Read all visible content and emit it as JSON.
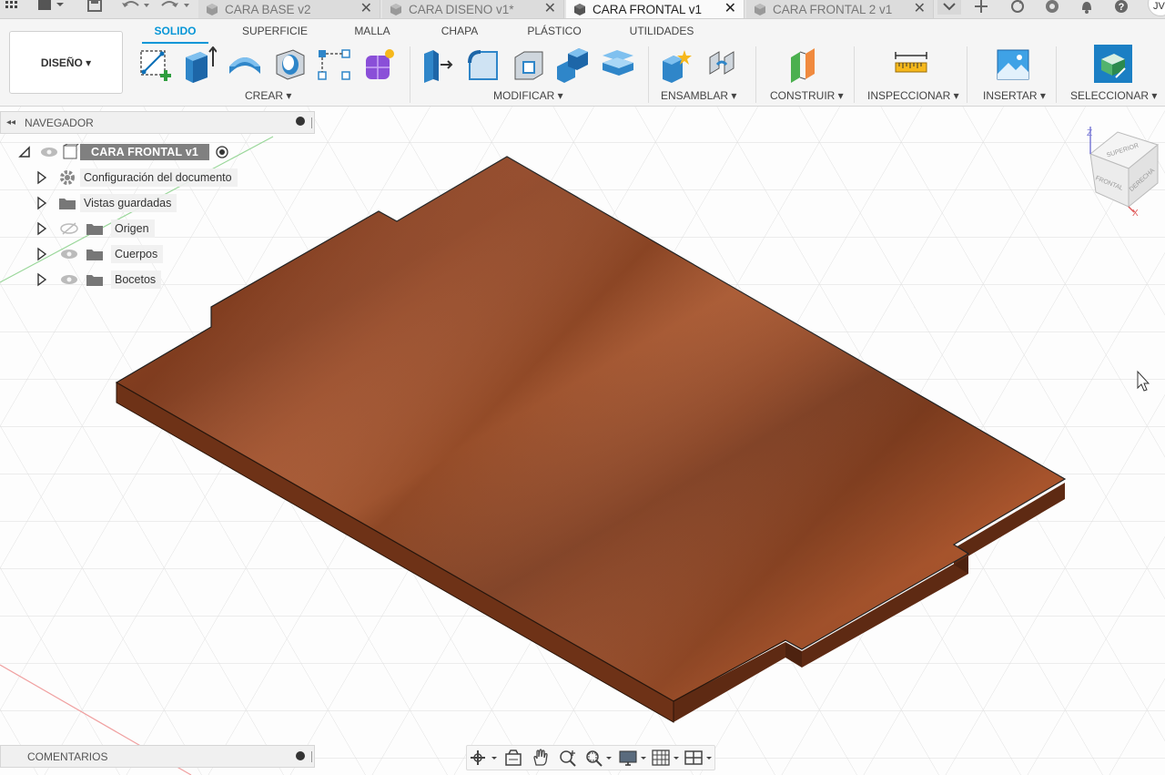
{
  "document_tabs": [
    {
      "name": "CARA BASE v2",
      "active": false
    },
    {
      "name": "CARA DISENO v1*",
      "active": false
    },
    {
      "name": "CARA FRONTAL v1",
      "active": true
    },
    {
      "name": "CARA FRONTAL 2 v1",
      "active": false
    }
  ],
  "tab_close_glyph": "✕",
  "user_initials": "JV",
  "workspace": {
    "label": "DISEÑO ▾"
  },
  "ribbon_tabs": [
    {
      "label": "SOLIDO",
      "active": true
    },
    {
      "label": "SUPERFICIE"
    },
    {
      "label": "MALLA"
    },
    {
      "label": "CHAPA"
    },
    {
      "label": "PLÁSTICO"
    },
    {
      "label": "UTILIDADES"
    }
  ],
  "tool_groups": [
    {
      "label": "CREAR ▾",
      "tools": [
        "create-sketch-icon",
        "extrude-icon",
        "revolve-icon",
        "hole-icon",
        "pattern-icon",
        "create-form-icon"
      ]
    },
    {
      "label": "MODIFICAR ▾",
      "tools": [
        "press-pull-icon",
        "fillet-icon",
        "shell-icon",
        "combine-icon",
        "offset-face-icon"
      ]
    },
    {
      "label": "ENSAMBLAR ▾",
      "tools": [
        "new-component-icon",
        "joint-icon"
      ]
    },
    {
      "label": "CONSTRUIR ▾",
      "tools": [
        "offset-plane-icon"
      ]
    },
    {
      "label": "INSPECCIONAR ▾",
      "tools": [
        "measure-icon"
      ]
    },
    {
      "label": "INSERTAR ▾",
      "tools": [
        "insert-image-icon"
      ]
    },
    {
      "label": "SELECCIONAR ▾",
      "tools": [
        "select-icon"
      ]
    }
  ],
  "navigator": {
    "title": "NAVEGADOR",
    "root": {
      "label": "CARA  FRONTAL v1"
    },
    "items": [
      {
        "label": "Configuración del documento",
        "icon": "gear-icon",
        "eye": "none"
      },
      {
        "label": "Vistas guardadas",
        "icon": "folder-icon",
        "eye": "none"
      },
      {
        "label": "Origen",
        "icon": "folder-icon",
        "eye": "hidden"
      },
      {
        "label": "Cuerpos",
        "icon": "folder-icon",
        "eye": "visible"
      },
      {
        "label": "Bocetos",
        "icon": "folder-icon",
        "eye": "visible"
      }
    ]
  },
  "comments": {
    "title": "COMENTARIOS"
  },
  "viewcube": {
    "top": "SUPERIOR",
    "front": "FRONTAL",
    "right": "DERECHA",
    "axis_z": "Z",
    "axis_x": "X"
  },
  "colors": {
    "accent": "#0696d7",
    "wood_dark": "#7a3a1c",
    "wood_mid": "#a24e2a",
    "wood_light": "#b8643a"
  }
}
